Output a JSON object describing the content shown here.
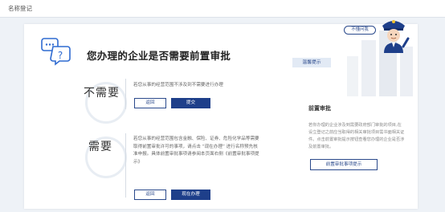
{
  "breadcrumb": "名称登记",
  "title": "您办理的企业是否需要前置审批",
  "options": [
    {
      "heading": "不需要",
      "description": "若您从事的经营范围不涉及到不需要进行办理",
      "buttons": {
        "back": "返回",
        "primary": "提交"
      }
    },
    {
      "heading": "需要",
      "description": "若您从事的经营范围包含金融、保险、证券、危险化学品等需要取得前置审批许可的事项，请点击 “现在办理” 进行名称预先核准申报。具体前置审批事项请参阅本页面右侧《前置审批事项提示》",
      "buttons": {
        "back": "返回",
        "primary": "现在办理"
      }
    }
  ],
  "sidebar": {
    "tag": "温馨提示",
    "title": "前置审批",
    "description": "若你办理的企业涉及到需要政府部门审批的项目,在设立登记之前应当取得的相关审批项目需书面相关证件。点击前置审批提示按钮查看您办理的企业是否涉及前置审批。",
    "button": "前置审批事项提示"
  },
  "speech_bubble": "不懂问我",
  "colors": {
    "brand": "#1e3f8a",
    "background": "#eef2f7"
  }
}
